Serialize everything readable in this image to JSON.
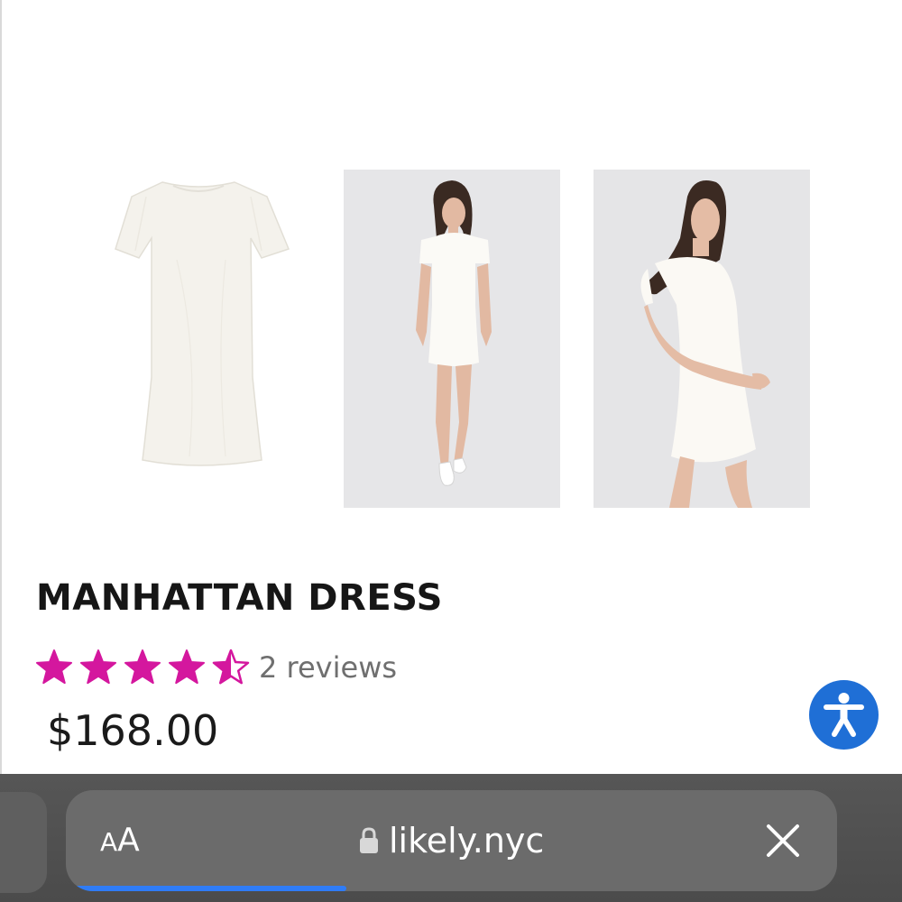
{
  "gallery": {
    "images": [
      {
        "name": "dress-flat-lay-image"
      },
      {
        "name": "dress-model-front-image"
      },
      {
        "name": "dress-model-side-image"
      }
    ]
  },
  "product": {
    "title": "MANHATTAN DRESS",
    "rating": {
      "value": 4.5,
      "max": 5,
      "star_color": "#d4179e",
      "reviews_text": "2 reviews"
    },
    "price": "$168.00"
  },
  "accessibility": {
    "icon": "accessibility-person-icon",
    "color": "#1f6fd6"
  },
  "browser": {
    "reader_button": {
      "small": "A",
      "big": "A"
    },
    "lock_icon": "lock-icon",
    "url": "likely.nyc",
    "clear_icon": "close-icon",
    "load_progress": 0.36,
    "progress_color": "#2f7cf6"
  }
}
